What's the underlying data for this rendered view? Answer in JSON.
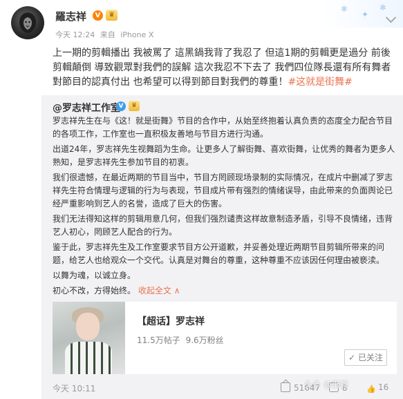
{
  "post": {
    "author": "羅志祥",
    "verified_badge": "V",
    "timestamp": "今天 12:24",
    "source_prefix": "来自",
    "source": "iPhone X",
    "text": "上一期的剪輯播出 我被罵了 這黑鍋我背了我忍了  但這1期的剪輯更是過分 前後剪輯顛倒 導致觀眾對我們的誤解 這次我忍不下去了 我們四位隊長還有所有舞者對節目的認真付出 也希望可以得到節目對我們的尊重！",
    "hashtag": "#这就是街舞#"
  },
  "repost": {
    "author": "@罗志祥工作室",
    "verified_badge": "V",
    "paragraphs": [
      "罗志祥先生在与《这！就是街舞》节目的合作中，从始至终抱着认真负责的态度全力配合节目的各项工作，工作室也一直积极友善地与节目方进行沟通。",
      "出道24年，罗志祥先生视舞蹈为生命。让更多人了解街舞、喜欢街舞，让优秀的舞者为更多人熟知，是罗志祥先生参加节目的初衷。",
      "我们很遗憾，在最近两期的节目当中，节目方罔顾现场录制的实际情况，在成片中删减了罗志祥先生符合情理与逻辑的行为与表现，节目成片带有强烈的情绪误导，由此带来的负面舆论已经严重影响到艺人的名誉，造成了巨大的伤害。",
      "我们无法得知这样的剪辑用意几何，但我们强烈谴责这样故意制造矛盾，引导不良情绪，违背艺人初心，罔顾艺人配合的行为。",
      "鉴于此，罗志祥先生及工作室要求节目方公开道歉，并妥善处理近两期节目剪辑所带来的问题，给艺人也给观众一个交代。认真是对舞台的尊重，这种尊重不应该因任何理由被亵渎。",
      "以舞为魂，以诚立身。"
    ],
    "last_line": "初心不改，方得始终。",
    "collapse_label": "收起全文",
    "collapse_arrow": "∧",
    "card": {
      "title": "【超话】罗志祥",
      "posts": "11.5万帖子",
      "fans": "9.6万粉丝",
      "follow_label": "已关注",
      "follow_check": "✓"
    },
    "time": "今天 10:11",
    "share_count": "51647",
    "comment_count": "8",
    "like_count": "16",
    "like_icon": "thumbs-up-icon"
  },
  "watermark": "头条 @街舞"
}
